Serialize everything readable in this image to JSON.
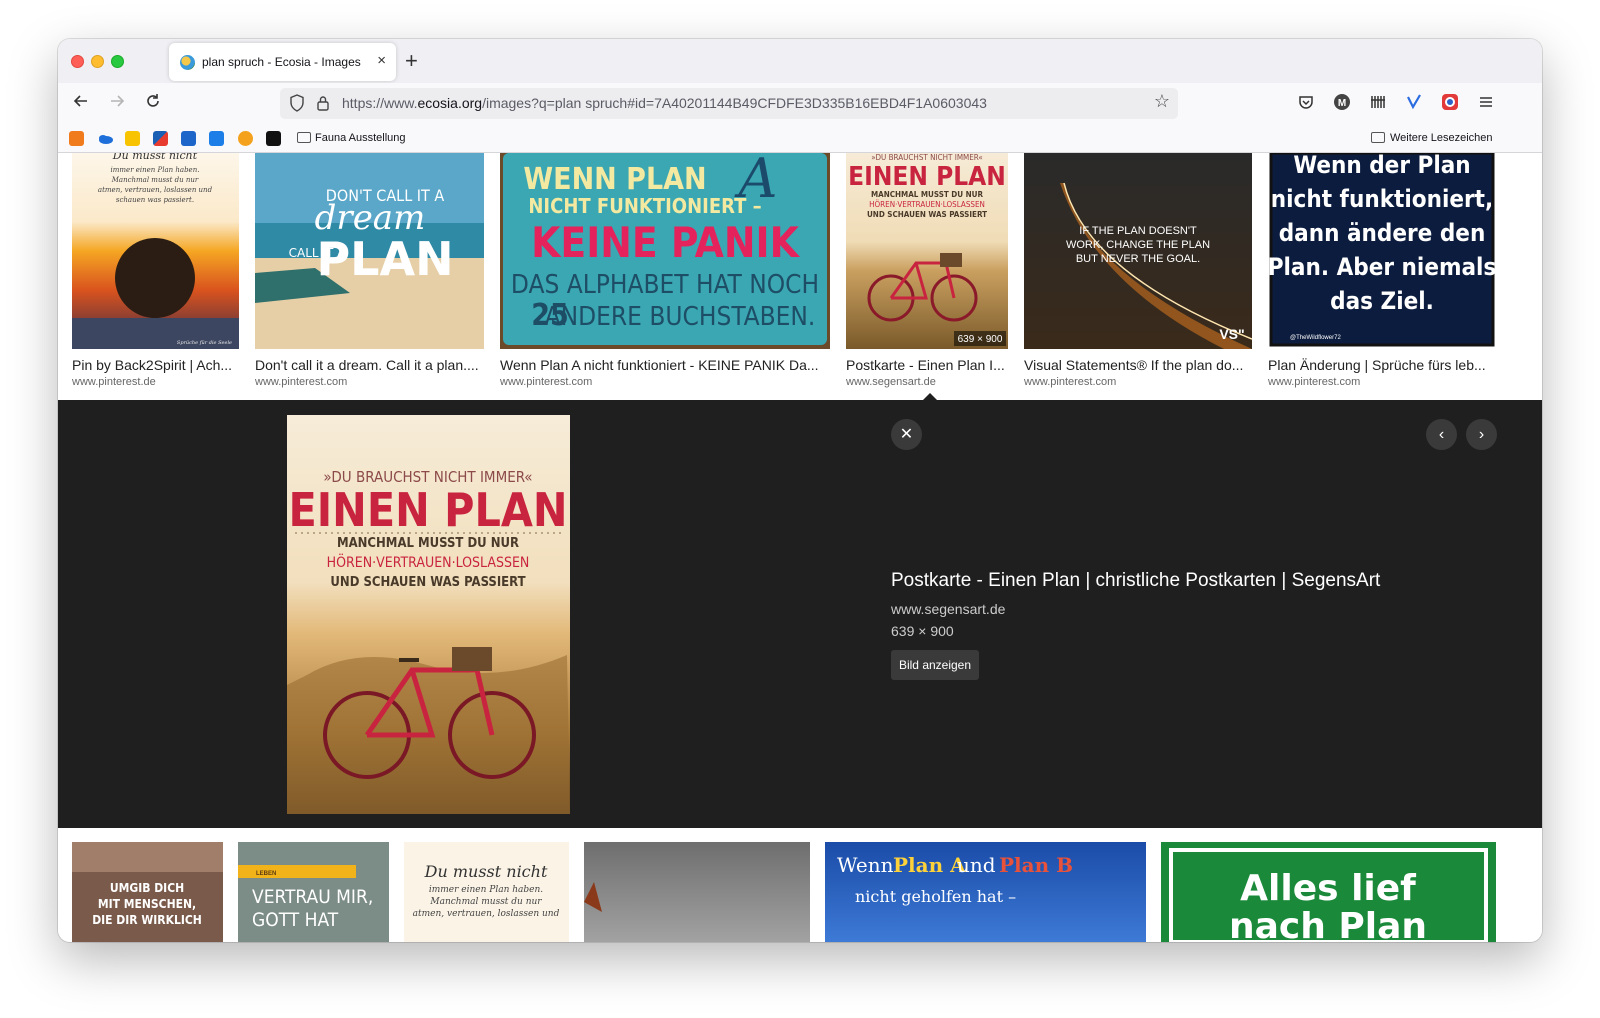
{
  "browser": {
    "tab_title": "plan spruch - Ecosia - Images",
    "tab_close": "×",
    "new_tab": "+",
    "url_prefix": "https://www.",
    "url_domain": "ecosia.org",
    "url_rest": "/images?q=plan spruch#id=7A40201144B49CFDFE3D335B16EBD4F1A0603043",
    "bookmarks": [
      {
        "label": "Fauna Ausstellung"
      },
      {
        "label": "Weitere Lesezeichen"
      }
    ]
  },
  "results_top": [
    {
      "title": "Pin by Back2Spirit | Ach...",
      "domain": "www.pinterest.de",
      "img_text_1": "Du musst nicht",
      "img_text_2": "immer einen Plan haben.",
      "img_text_3": "Manchmal musst du nur",
      "img_text_4": "atmen, vertrauen, loslassen und",
      "img_text_5": "schauen was passiert.",
      "img_text_6": "Sprüche für die Seele"
    },
    {
      "title": "Don't call it a dream. Call it a plan....",
      "domain": "www.pinterest.com",
      "img_text_1": "DON'T CALL IT A",
      "img_text_2": "dream",
      "img_text_3": "CALL IT A",
      "img_text_4": "PLAN"
    },
    {
      "title": "Wenn Plan A nicht funktioniert - KEINE PANIK Da...",
      "domain": "www.pinterest.com",
      "img_text_1": "WENN PLAN",
      "img_text_2": "A",
      "img_text_3": "NICHT FUNKTIONIERT –",
      "img_text_4": "KEINE PANIK",
      "img_text_5": "DAS ALPHABET HAT NOCH",
      "img_text_6": "25",
      "img_text_7": "ANDERE BUCHSTABEN."
    },
    {
      "title": "Postkarte - Einen Plan I...",
      "domain": "www.segensart.de",
      "img_text_1": "»DU BRAUCHST NICHT IMMER«",
      "img_text_2": "EINEN PLAN",
      "img_text_3": "MANCHMAL MUSST DU NUR",
      "img_text_4": "HÖREN·VERTRAUEN·LOSLASSEN",
      "img_text_5": "UND SCHAUEN WAS PASSIERT",
      "size_badge": "639 × 900"
    },
    {
      "title": "Visual Statements® If the plan do...",
      "domain": "www.pinterest.com",
      "img_text_1": "IF THE PLAN DOESN'T",
      "img_text_2": "WORK, CHANGE THE PLAN",
      "img_text_3": "BUT NEVER THE GOAL.",
      "img_text_4": "VS\""
    },
    {
      "title": "Plan Änderung | Sprüche fürs leb...",
      "domain": "www.pinterest.com",
      "img_text_1": "Wenn der Plan",
      "img_text_2": "nicht funktioniert,",
      "img_text_3": "dann ändere den",
      "img_text_4": "Plan. Aber niemals",
      "img_text_5": "das Ziel.",
      "img_text_6": "@TheWildflower72"
    }
  ],
  "preview": {
    "title": "Postkarte - Einen Plan | christliche Postkarten | SegensArt",
    "domain": "www.segensart.de",
    "size": "639 × 900",
    "button_label": "Bild anzeigen",
    "close": "✕",
    "prev": "‹",
    "next": "›",
    "img_text_1": "»DU BRAUCHST NICHT IMMER«",
    "img_text_2": "EINEN PLAN",
    "img_text_3": "MANCHMAL MUSST DU NUR",
    "img_text_4": "HÖREN·VERTRAUEN·LOSLASSEN",
    "img_text_5": "UND SCHAUEN WAS PASSIERT"
  },
  "results_bottom": [
    {
      "img_text_1": "UMGIB DICH",
      "img_text_2": "MIT MENSCHEN,",
      "img_text_3": "DIE DIR WIRKLICH"
    },
    {
      "img_text_1": "LEBEN",
      "img_text_2": "VERTRAU MIR,",
      "img_text_3": "GOTT HAT"
    },
    {
      "img_text_1": "Du musst nicht",
      "img_text_2": "immer einen Plan haben.",
      "img_text_3": "Manchmal musst du nur",
      "img_text_4": "atmen, vertrauen, loslassen und"
    },
    {},
    {
      "img_text_1": "Wenn",
      "img_text_2": "Plan A",
      "img_text_3": "und",
      "img_text_4": "Plan B",
      "img_text_5": "nicht geholfen hat –"
    },
    {
      "img_text_1": "Alles lief",
      "img_text_2": "nach Plan"
    }
  ],
  "colors": {
    "panel_bg": "#1f1f1f",
    "button_bg": "#3a3a3a",
    "accent_pink": "#e4235c",
    "accent_teal": "#3aa7b3"
  }
}
